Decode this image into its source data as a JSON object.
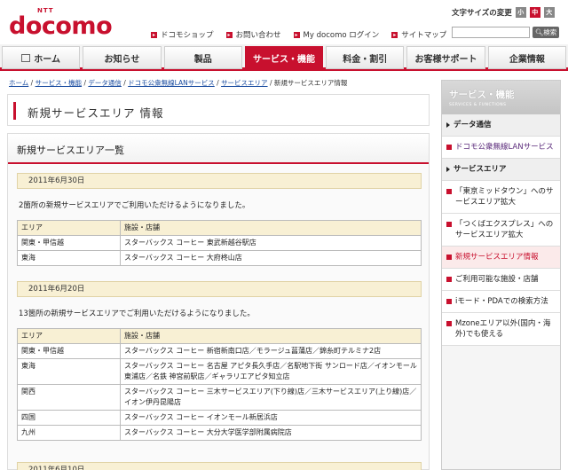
{
  "header": {
    "logo_small": "NTT",
    "logo": "docomo",
    "util_links": [
      "ドコモショップ",
      "お問い合わせ",
      "My docomo ログイン",
      "サイトマップ"
    ],
    "fontsize_label": "文字サイズの変更",
    "fontsize_options": [
      "小",
      "中",
      "大"
    ],
    "search_button": "検索"
  },
  "nav": {
    "tabs": [
      "ホーム",
      "お知らせ",
      "製品",
      "サービス・機能",
      "料金・割引",
      "お客様サポート",
      "企業情報"
    ],
    "active": "サービス・機能"
  },
  "breadcrumb": {
    "links": [
      "ホーム",
      "サービス・機能",
      "データ通信",
      "ドコモ公衆無線LANサービス",
      "サービスエリア"
    ],
    "current": "新規サービスエリア情報",
    "separator": " / "
  },
  "page_title": "新規サービスエリア 情報",
  "section": {
    "title": "新規サービスエリア一覧",
    "entries": [
      {
        "date": "2011年6月30日",
        "intro": "2箇所の新規サービスエリアでご利用いただけるようになりました。",
        "headers": [
          "エリア",
          "施設・店舗"
        ],
        "rows": [
          [
            "関東・甲信越",
            "スターバックス コーヒー 東武新越谷駅店"
          ],
          [
            "東海",
            "スターバックス コーヒー 大府柊山店"
          ]
        ]
      },
      {
        "date": "2011年6月20日",
        "intro": "13箇所の新規サービスエリアでご利用いただけるようになりました。",
        "headers": [
          "エリア",
          "施設・店舗"
        ],
        "rows": [
          [
            "関東・甲信越",
            "スターバックス コーヒー 新宿新南口店／モラージュ菖蒲店／錦糸町テルミナ2店"
          ],
          [
            "東海",
            "スターバックス コーヒー 名古屋 アピタ長久手店／名駅地下街 サンロード店／イオンモール東浦店／名鉄 神宮前駅店／ギャラリエアピタ知立店"
          ],
          [
            "関西",
            "スターバックス コーヒー 三木サービスエリア(下り線)店／三木サービスエリア(上り線)店／イオン伊丹昆陽店"
          ],
          [
            "四国",
            "スターバックス コーヒー イオンモール新居浜店"
          ],
          [
            "九州",
            "スターバックス コーヒー 大分大学医学部附属病院店"
          ]
        ]
      }
    ],
    "next_date": "2011年6月10日"
  },
  "sidebar": {
    "title": "サービス・機能",
    "subtitle": "SERVICES & FUNCTIONS",
    "items": [
      {
        "label": "データ通信",
        "kind": "category"
      },
      {
        "label": "ドコモ公衆無線LANサービス",
        "kind": "purple"
      },
      {
        "label": "サービスエリア",
        "kind": "category"
      },
      {
        "label": "「東京ミッドタウン」へのサービスエリア拡大",
        "kind": "link"
      },
      {
        "label": "「つくばエクスプレス」へのサービスエリア拡大",
        "kind": "link"
      },
      {
        "label": "新規サービスエリア情報",
        "kind": "current"
      },
      {
        "label": "ご利用可能な施設・店舗",
        "kind": "link"
      },
      {
        "label": "iモード・PDAでの検索方法",
        "kind": "link"
      },
      {
        "label": "Mzoneエリア以外(国内・海外)でも使える",
        "kind": "link"
      }
    ]
  },
  "colors": {
    "brand": "#c8102e",
    "date_band": "#f8f0d4",
    "link": "#1a4ca0"
  }
}
